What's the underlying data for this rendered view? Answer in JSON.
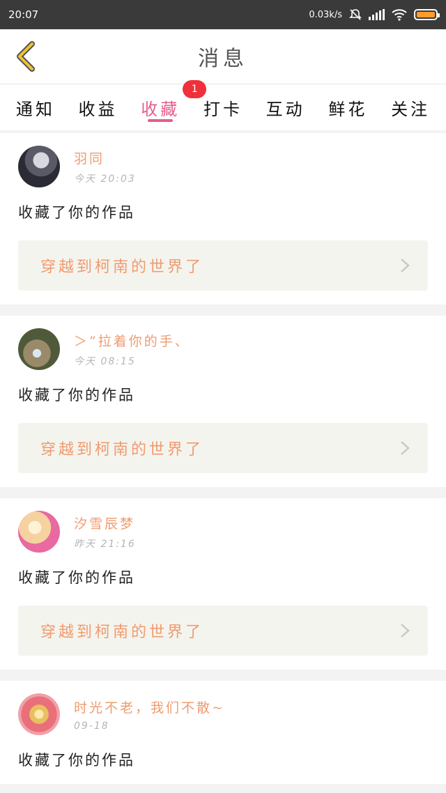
{
  "status": {
    "time": "20:07",
    "speed": "0.03k/s",
    "battery_color": "#ff9d2a"
  },
  "header": {
    "title": "消息",
    "back_icon": "chevron-left-icon",
    "back_color": "#f0c23a"
  },
  "tabs": [
    {
      "label": "通知",
      "active": false
    },
    {
      "label": "收益",
      "active": false
    },
    {
      "label": "收藏",
      "active": true,
      "badge": "1"
    },
    {
      "label": "打卡",
      "active": false
    },
    {
      "label": "互动",
      "active": false
    },
    {
      "label": "鲜花",
      "active": false
    },
    {
      "label": "关注",
      "active": false
    }
  ],
  "colors": {
    "accent": "#e85c8c",
    "username": "#ef9b6f",
    "badge": "#f0303a"
  },
  "messages": [
    {
      "username": "羽同",
      "time": "今天 20:03",
      "action": "收藏了你的作品",
      "work": "穿越到柯南的世界了",
      "avatar_colors": [
        "#2b2b35",
        "#d8d8de"
      ]
    },
    {
      "username": "＞”拉着你的手、",
      "time": "今天 08:15",
      "action": "收藏了你的作品",
      "work": "穿越到柯南的世界了",
      "avatar_colors": [
        "#4e5a3a",
        "#9a8a6a"
      ]
    },
    {
      "username": "汐雪辰梦",
      "time": "昨天 21:16",
      "action": "收藏了你的作品",
      "work": "穿越到柯南的世界了",
      "avatar_colors": [
        "#f5d2a0",
        "#e86aa0"
      ]
    },
    {
      "username": "时光不老，我们不散~",
      "time": "09-18",
      "action": "收藏了你的作品",
      "work": "",
      "avatar_colors": [
        "#f2a0a8",
        "#e8c060"
      ]
    }
  ]
}
